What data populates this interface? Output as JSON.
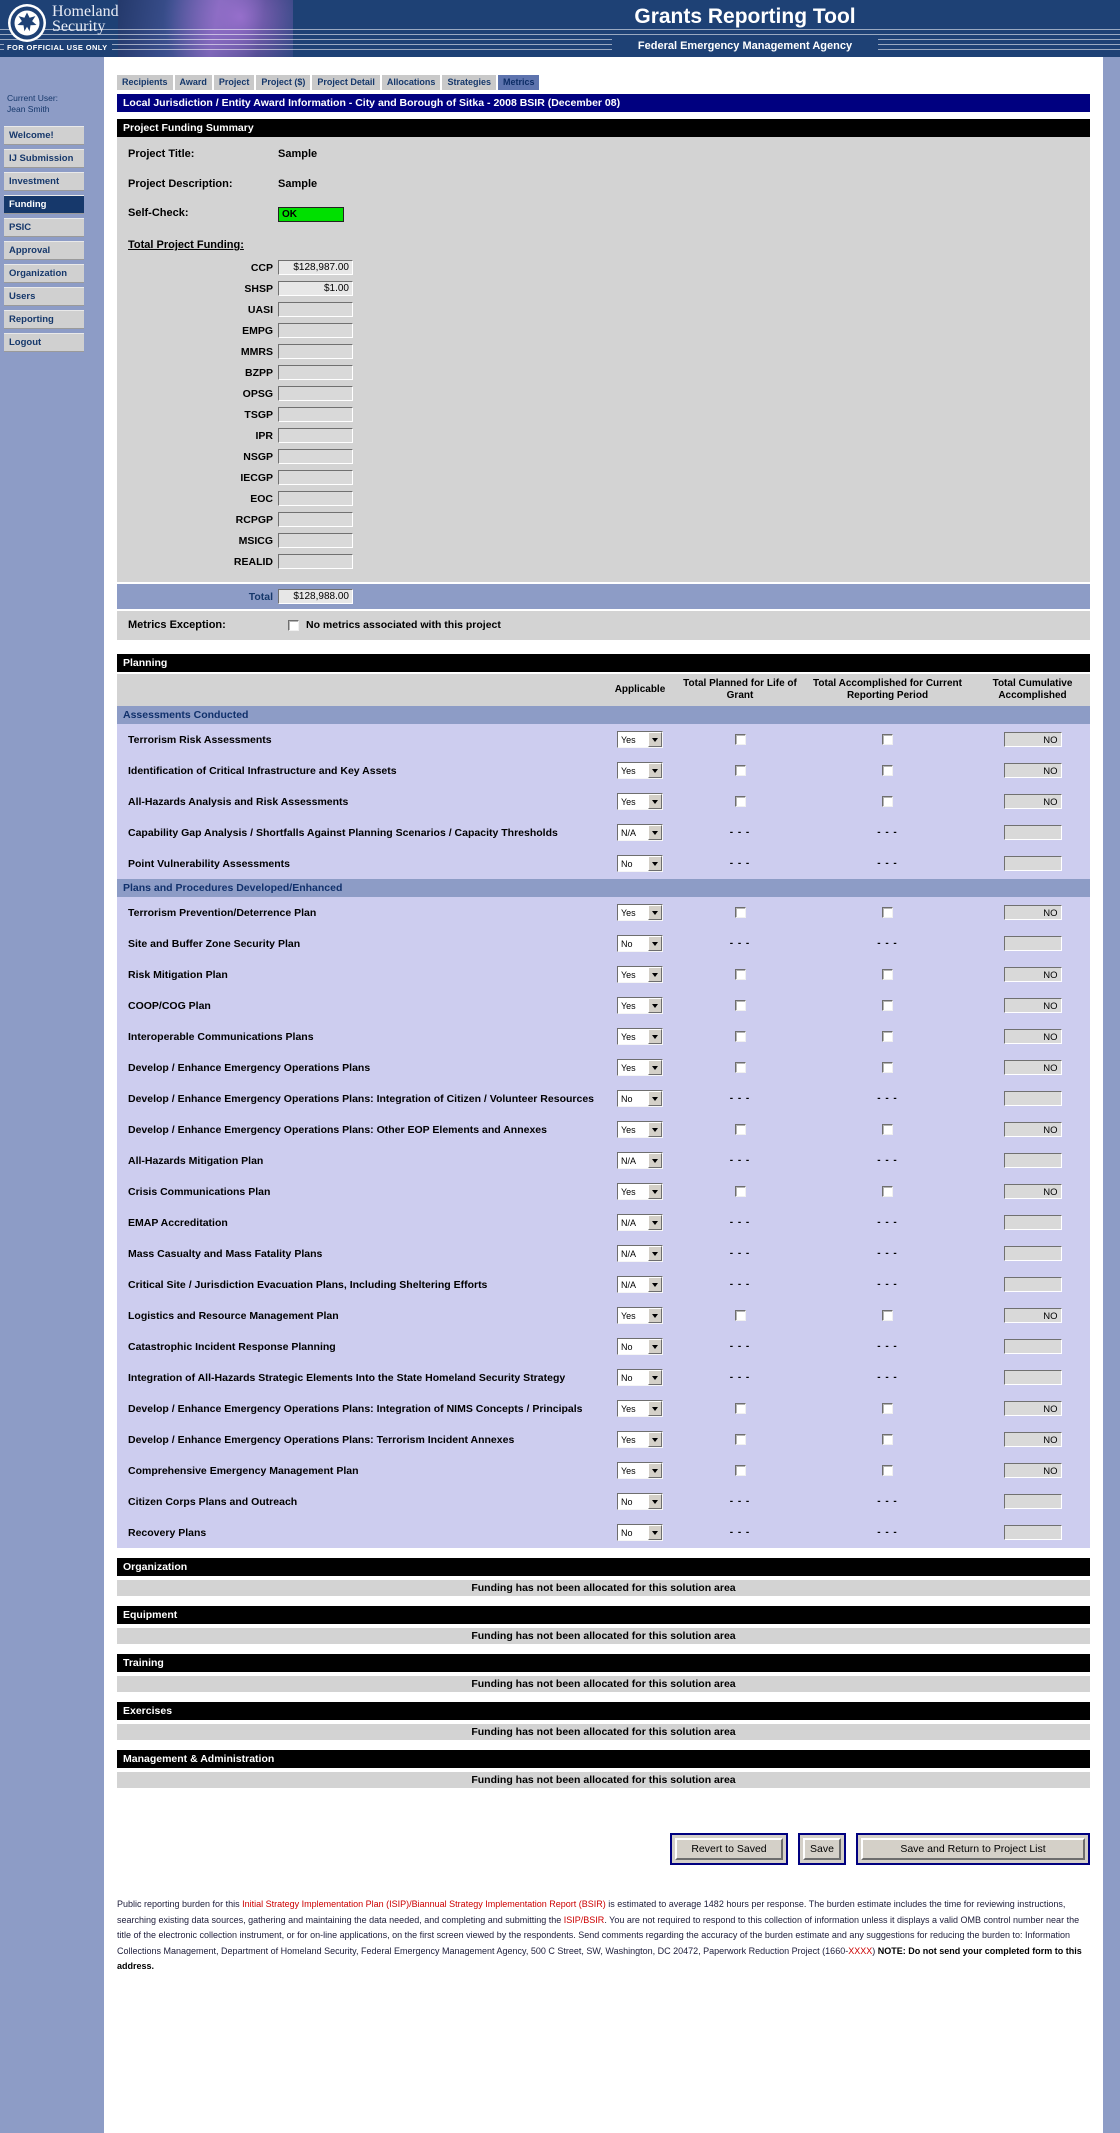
{
  "header": {
    "brand_line1": "Homeland",
    "brand_line2": "Security",
    "fouo": "FOR OFFICIAL USE ONLY",
    "app_title": "Grants Reporting Tool",
    "app_subtitle": "Federal Emergency Management Agency",
    "banner_color": "#1e4175"
  },
  "tabs": [
    {
      "label": "Recipients",
      "active": false
    },
    {
      "label": "Award",
      "active": false
    },
    {
      "label": "Project",
      "active": false
    },
    {
      "label": "Project ($)",
      "active": false
    },
    {
      "label": "Project Detail",
      "active": false
    },
    {
      "label": "Allocations",
      "active": false
    },
    {
      "label": "Strategies",
      "active": false
    },
    {
      "label": "Metrics",
      "active": true
    }
  ],
  "sidebar": {
    "current_user_label": "Current User:",
    "current_user_name": "Jean Smith",
    "items": [
      {
        "label": "Welcome!",
        "active": false
      },
      {
        "label": "IJ Submission",
        "active": false
      },
      {
        "label": "Investment",
        "active": false
      },
      {
        "label": "Funding",
        "active": true
      },
      {
        "label": "PSIC",
        "active": false
      },
      {
        "label": "Approval",
        "active": false
      },
      {
        "label": "Organization",
        "active": false
      },
      {
        "label": "Users",
        "active": false
      },
      {
        "label": "Reporting",
        "active": false
      },
      {
        "label": "Logout",
        "active": false
      }
    ]
  },
  "page": {
    "title_bar": "Local Jurisdiction / Entity Award Information - City and Borough of Sitka - 2008 BSIR (December 08)",
    "funding_summary": {
      "section_title": "Project Funding Summary",
      "project_title_label": "Project Title:",
      "project_title": "Sample",
      "project_description_label": "Project Description:",
      "project_description": "Sample",
      "self_check_label": "Self-Check:",
      "self_check_value": "OK",
      "self_check_color": "#00e000",
      "total_project_funding_label": "Total Project Funding:",
      "funding_fields": [
        {
          "code": "CCP",
          "value": "$128,987.00"
        },
        {
          "code": "SHSP",
          "value": "$1.00"
        },
        {
          "code": "UASI",
          "value": ""
        },
        {
          "code": "EMPG",
          "value": ""
        },
        {
          "code": "MMRS",
          "value": ""
        },
        {
          "code": "BZPP",
          "value": ""
        },
        {
          "code": "OPSG",
          "value": ""
        },
        {
          "code": "TSGP",
          "value": ""
        },
        {
          "code": "IPR",
          "value": ""
        },
        {
          "code": "NSGP",
          "value": ""
        },
        {
          "code": "IECGP",
          "value": ""
        },
        {
          "code": "EOC",
          "value": ""
        },
        {
          "code": "RCPGP",
          "value": ""
        },
        {
          "code": "MSICG",
          "value": ""
        },
        {
          "code": "REALID",
          "value": ""
        }
      ],
      "total_label": "Total",
      "total_value": "$128,988.00",
      "metrics_exception_label": "Metrics Exception:",
      "metrics_exception_checkbox_label": "No metrics associated with this project",
      "metrics_exception_checked": false
    },
    "planning": {
      "section_title": "Planning",
      "columns": [
        "Applicable",
        "Total Planned for Life of Grant",
        "Total Accomplished for Current Reporting Period",
        "Total Cumulative Accomplished"
      ],
      "dashes": "- - -",
      "groups": [
        {
          "name": "Assessments Conducted",
          "rows": [
            {
              "label": "Terrorism Risk Assessments",
              "applicable": "Yes",
              "cumulative": "NO"
            },
            {
              "label": "Identification of Critical Infrastructure and Key Assets",
              "applicable": "Yes",
              "cumulative": "NO"
            },
            {
              "label": "All-Hazards Analysis and Risk Assessments",
              "applicable": "Yes",
              "cumulative": "NO"
            },
            {
              "label": "Capability Gap Analysis / Shortfalls Against Planning Scenarios / Capacity Thresholds",
              "applicable": "N/A",
              "cumulative": ""
            },
            {
              "label": "Point Vulnerability Assessments",
              "applicable": "No",
              "cumulative": ""
            }
          ]
        },
        {
          "name": "Plans and Procedures Developed/Enhanced",
          "rows": [
            {
              "label": "Terrorism Prevention/Deterrence Plan",
              "applicable": "Yes",
              "cumulative": "NO"
            },
            {
              "label": "Site and Buffer Zone Security Plan",
              "applicable": "No",
              "cumulative": ""
            },
            {
              "label": "Risk Mitigation Plan",
              "applicable": "Yes",
              "cumulative": "NO"
            },
            {
              "label": "COOP/COG Plan",
              "applicable": "Yes",
              "cumulative": "NO"
            },
            {
              "label": "Interoperable Communications Plans",
              "applicable": "Yes",
              "cumulative": "NO"
            },
            {
              "label": "Develop / Enhance Emergency Operations Plans",
              "applicable": "Yes",
              "cumulative": "NO"
            },
            {
              "label": "Develop / Enhance Emergency Operations Plans: Integration of Citizen / Volunteer Resources",
              "applicable": "No",
              "cumulative": ""
            },
            {
              "label": "Develop / Enhance Emergency Operations Plans: Other EOP Elements and Annexes",
              "applicable": "Yes",
              "cumulative": "NO"
            },
            {
              "label": "All-Hazards Mitigation Plan",
              "applicable": "N/A",
              "cumulative": ""
            },
            {
              "label": "Crisis Communications Plan",
              "applicable": "Yes",
              "cumulative": "NO"
            },
            {
              "label": "EMAP Accreditation",
              "applicable": "N/A",
              "cumulative": ""
            },
            {
              "label": "Mass Casualty and Mass Fatality Plans",
              "applicable": "N/A",
              "cumulative": ""
            },
            {
              "label": "Critical Site / Jurisdiction Evacuation Plans, Including Sheltering Efforts",
              "applicable": "N/A",
              "cumulative": ""
            },
            {
              "label": "Logistics and Resource Management Plan",
              "applicable": "Yes",
              "cumulative": "NO"
            },
            {
              "label": "Catastrophic Incident Response Planning",
              "applicable": "No",
              "cumulative": ""
            },
            {
              "label": "Integration of All-Hazards Strategic Elements Into the State Homeland Security Strategy",
              "applicable": "No",
              "cumulative": ""
            },
            {
              "label": "Develop / Enhance Emergency Operations Plans: Integration of NIMS Concepts / Principals",
              "applicable": "Yes",
              "cumulative": "NO"
            },
            {
              "label": "Develop / Enhance Emergency Operations Plans: Terrorism Incident Annexes",
              "applicable": "Yes",
              "cumulative": "NO"
            },
            {
              "label": "Comprehensive Emergency Management Plan",
              "applicable": "Yes",
              "cumulative": "NO"
            },
            {
              "label": "Citizen Corps Plans and Outreach",
              "applicable": "No",
              "cumulative": ""
            },
            {
              "label": "Recovery Plans",
              "applicable": "No",
              "cumulative": ""
            }
          ]
        }
      ]
    },
    "empty_sections": [
      {
        "title": "Organization",
        "message": "Funding has not been allocated for this solution area"
      },
      {
        "title": "Equipment",
        "message": "Funding has not been allocated for this solution area"
      },
      {
        "title": "Training",
        "message": "Funding has not been allocated for this solution area"
      },
      {
        "title": "Exercises",
        "message": "Funding has not been allocated for this solution area"
      },
      {
        "title": "Management & Administration",
        "message": "Funding has not been allocated for this solution area"
      }
    ],
    "buttons": [
      {
        "label": "Revert to Saved",
        "size": "w1"
      },
      {
        "label": "Save",
        "size": "w2"
      },
      {
        "label": "Save and Return to Project List",
        "size": "w3"
      }
    ],
    "footer_segments": [
      {
        "text": "Public reporting burden for this ",
        "style": "normal"
      },
      {
        "text": "Initial Strategy Implementation Plan (ISIP)/Biannual Strategy Implementation Report (BSIR)",
        "style": "red"
      },
      {
        "text": " is estimated to average 1482 hours per response. The burden estimate includes the time for reviewing instructions, searching existing data sources, gathering and maintaining the data needed, and completing and submitting the ",
        "style": "normal"
      },
      {
        "text": "ISIP/BSIR",
        "style": "red"
      },
      {
        "text": ". You are not required to respond to this collection of information unless it displays a valid OMB control number near the title of the electronic collection instrument, or for on-line applications, on the first screen viewed by the respondents. Send comments regarding the accuracy of the burden estimate and any suggestions for reducing the burden to: Information Collections Management, Department of Homeland Security, Federal Emergency Management Agency, 500 C Street, SW, Washington, DC 20472, Paperwork Reduction Project (1660-",
        "style": "normal"
      },
      {
        "text": "XXXX",
        "style": "red"
      },
      {
        "text": ") ",
        "style": "normal"
      },
      {
        "text": "NOTE: Do not send your completed form to this address.",
        "style": "bold"
      }
    ]
  }
}
